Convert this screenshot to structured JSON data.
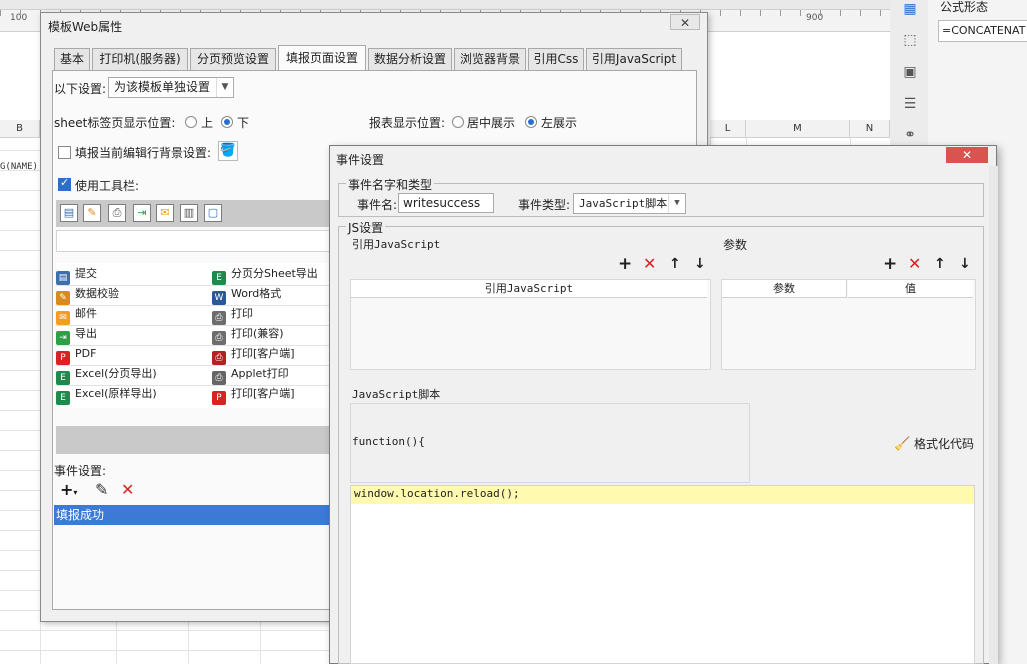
{
  "background": {
    "ruler_labels": [
      "100",
      "900"
    ],
    "columns": [
      "B",
      "L",
      "M",
      "N"
    ],
    "row_fragment": "G(NAME)",
    "formula_panel_title": "公式形态",
    "formula_value": "=CONCATENAT"
  },
  "web_dialog": {
    "title": "模板Web属性",
    "tabs": [
      {
        "label": "基本"
      },
      {
        "label": "打印机(服务器)"
      },
      {
        "label": "分页预览设置"
      },
      {
        "label": "填报页面设置"
      },
      {
        "label": "数据分析设置"
      },
      {
        "label": "浏览器背景"
      },
      {
        "label": "引用Css"
      },
      {
        "label": "引用JavaScript"
      }
    ],
    "active_tab": "填报页面设置",
    "settings_label": "以下设置:",
    "settings_value": "为该模板单独设置",
    "sheet_pos_label": "sheet标签页显示位置:",
    "sheet_pos_options": [
      "上",
      "下"
    ],
    "sheet_pos_selected": "下",
    "report_pos_label": "报表显示位置:",
    "report_pos_options": [
      "居中展示",
      "左展示"
    ],
    "report_pos_selected": "左展示",
    "fill_bg_label": "填报当前编辑行背景设置:",
    "use_toolbar_label": "使用工具栏:",
    "button_list": [
      {
        "label": "提交",
        "icon": "save-icon",
        "color": "#3a6fb0"
      },
      {
        "label": "分页分Sheet导出",
        "icon": "excel-icon",
        "color": "#1f8a4c"
      },
      {
        "label": "数据校验",
        "icon": "pencil-icon",
        "color": "#d98a1c"
      },
      {
        "label": "Word格式",
        "icon": "word-icon",
        "color": "#2b5797"
      },
      {
        "label": "邮件",
        "icon": "mail-icon",
        "color": "#f0a020"
      },
      {
        "label": "打印",
        "icon": "print-icon",
        "color": "#6d6d6d"
      },
      {
        "label": "导出",
        "icon": "export-icon",
        "color": "#2f9e48"
      },
      {
        "label": "打印(兼容)",
        "icon": "print-icon",
        "color": "#6d6d6d"
      },
      {
        "label": "PDF",
        "icon": "pdf-icon",
        "color": "#d92222"
      },
      {
        "label": "打印[客户端]",
        "icon": "print-client-icon",
        "color": "#b22222"
      },
      {
        "label": "Excel(分页导出)",
        "icon": "excel-icon",
        "color": "#1f8a4c"
      },
      {
        "label": "Applet打印",
        "icon": "applet-print-icon",
        "color": "#666666"
      },
      {
        "label": "Excel(原样导出)",
        "icon": "excel-icon",
        "color": "#1f8a4c"
      },
      {
        "label": "打印[客户端]",
        "icon": "pdf-print-icon",
        "color": "#d92222"
      }
    ],
    "event_settings_label": "事件设置:",
    "event_items": [
      "填报成功"
    ]
  },
  "event_dialog": {
    "title": "事件设置",
    "group_name_type": "事件名字和类型",
    "event_name_label": "事件名:",
    "event_name_value": "writesuccess",
    "event_type_label": "事件类型:",
    "event_type_value": "JavaScript脚本",
    "group_js": "JS设置",
    "ref_js_label": "引用JavaScript",
    "ref_js_header": "引用JavaScript",
    "params_label": "参数",
    "params_headers": [
      "参数",
      "值"
    ],
    "script_label": "JavaScript脚本",
    "function_header": "function(){",
    "format_code_label": "格式化代码",
    "code_line": "window.location.reload();"
  },
  "colors": {
    "selection_blue": "#3d7ad6",
    "delete_red": "#d92222",
    "code_highlight": "#fffab0",
    "close_red": "#d9534f"
  }
}
